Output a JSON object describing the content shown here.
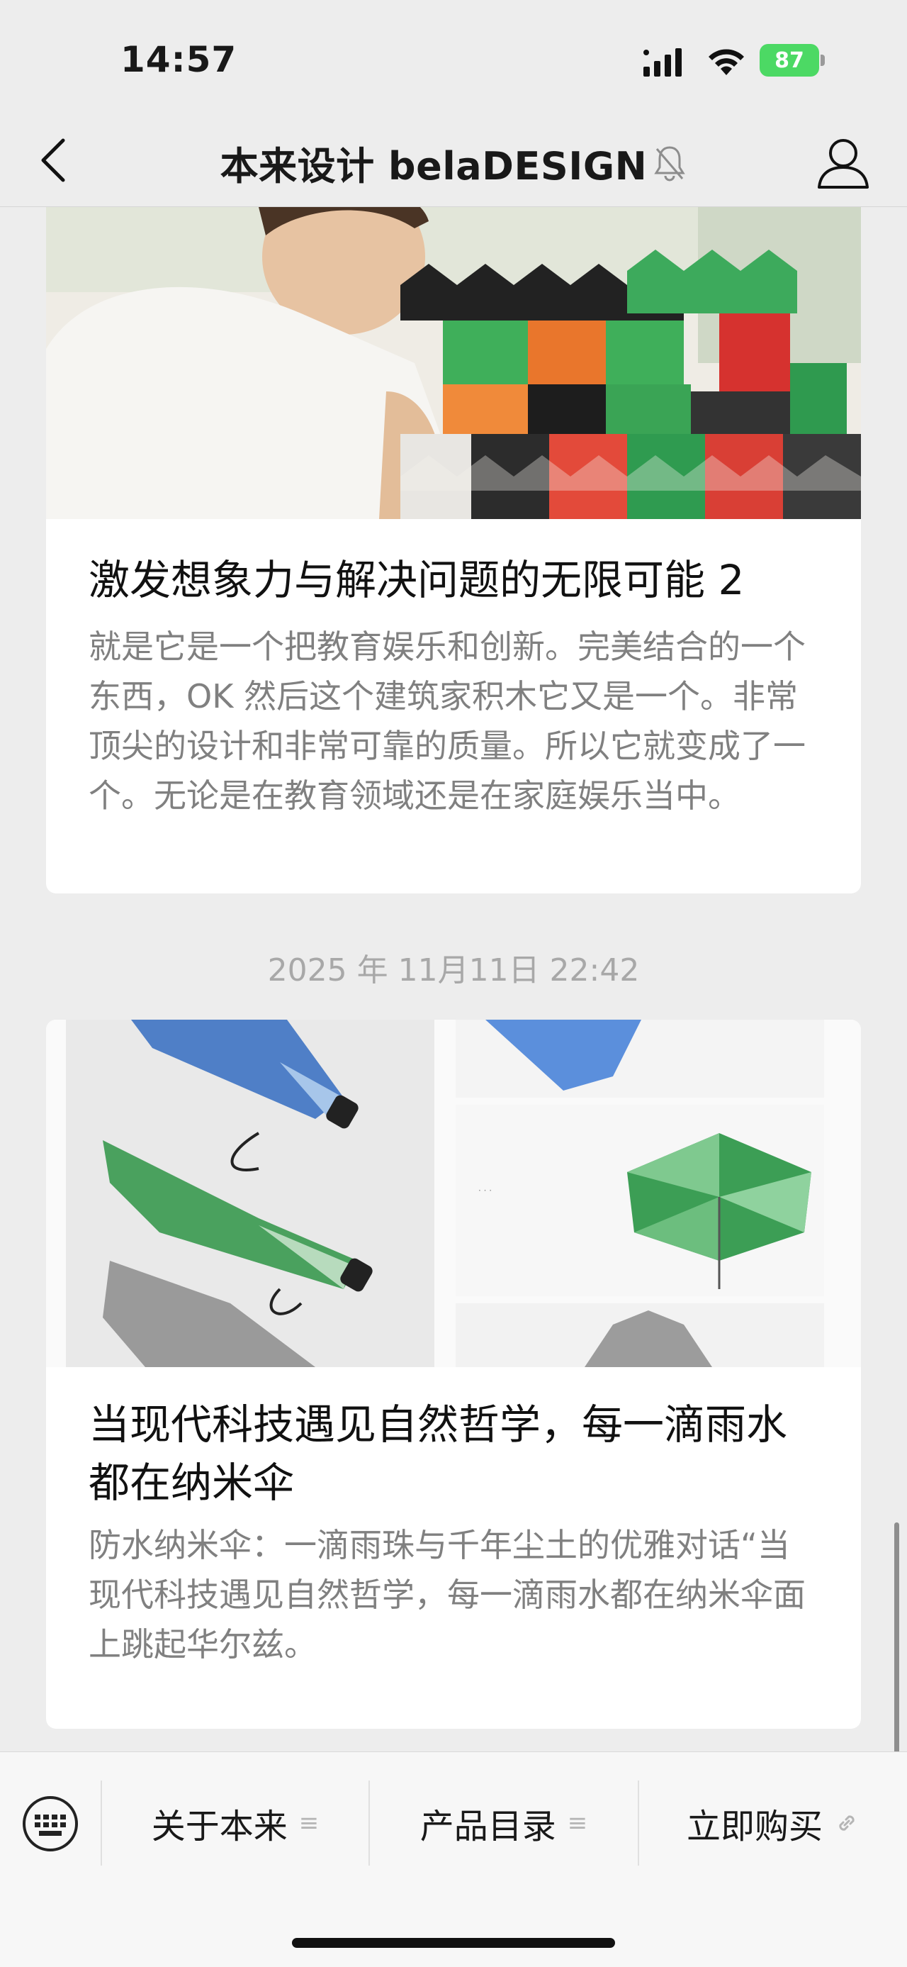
{
  "status_bar": {
    "time": "14:57",
    "battery": "87"
  },
  "nav": {
    "title": "本来设计 belaDESIGN"
  },
  "articles": [
    {
      "title": "激发想象力与解决问题的无限可能 2",
      "summary": "就是它是一个把教育娱乐和创新。完美结合的一个东西，OK 然后这个建筑家积木它又是一个。非常顶尖的设计和非常可靠的质量。所以它就变成了一个。无论是在教育领域还是在家庭娱乐当中。"
    },
    {
      "title": "当现代科技遇见自然哲学，每一滴雨水都在纳米伞",
      "summary": "防水纳米伞：一滴雨珠与千年尘土的优雅对话“当现代科技遇见自然哲学，每一滴雨水都在纳米伞面上跳起华尔兹。"
    }
  ],
  "timestamp": "2025 年 11月11日 22:42",
  "menu": {
    "items": [
      {
        "label": "关于本来",
        "icon": "list-icon"
      },
      {
        "label": "产品目录",
        "icon": "list-icon"
      },
      {
        "label": "立即购买",
        "icon": "link-icon"
      }
    ]
  },
  "colors": {
    "accent": "#4cd964",
    "background": "#ededed",
    "card": "#ffffff"
  }
}
